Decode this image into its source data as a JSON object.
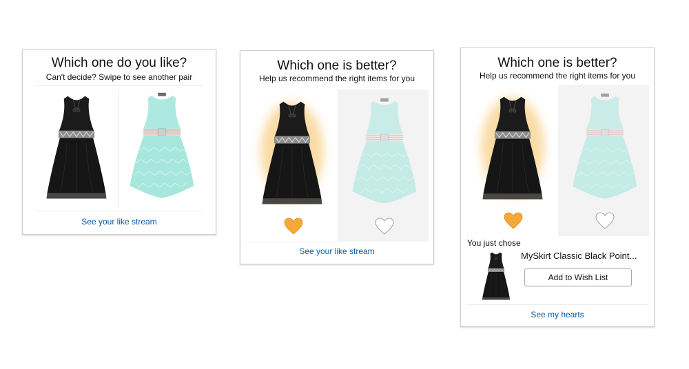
{
  "card1": {
    "title": "Which one do you like?",
    "subtitle": "Can't decide? Swipe to see another pair",
    "link": "See your like stream"
  },
  "card2": {
    "title": "Which one is better?",
    "subtitle": "Help us recommend the right items for you",
    "link": "See your like stream"
  },
  "card3": {
    "title": "Which one is better?",
    "subtitle": "Help us recommend the right items for you",
    "chose_label": "You just chose",
    "product_title": "MySkirt Classic Black Point...",
    "wish_button": "Add to Wish List",
    "link": "See my hearts"
  },
  "icons": {
    "heart_filled": "heart-filled-icon",
    "heart_outline": "heart-outline-icon"
  },
  "colors": {
    "link": "#0a5aa8",
    "heart": "#f5a93b",
    "glow": "#f7c46a",
    "black_dress": "#1a1a1a",
    "mint_dress": "#a9e8e0",
    "belt": "#9a9a9a"
  }
}
